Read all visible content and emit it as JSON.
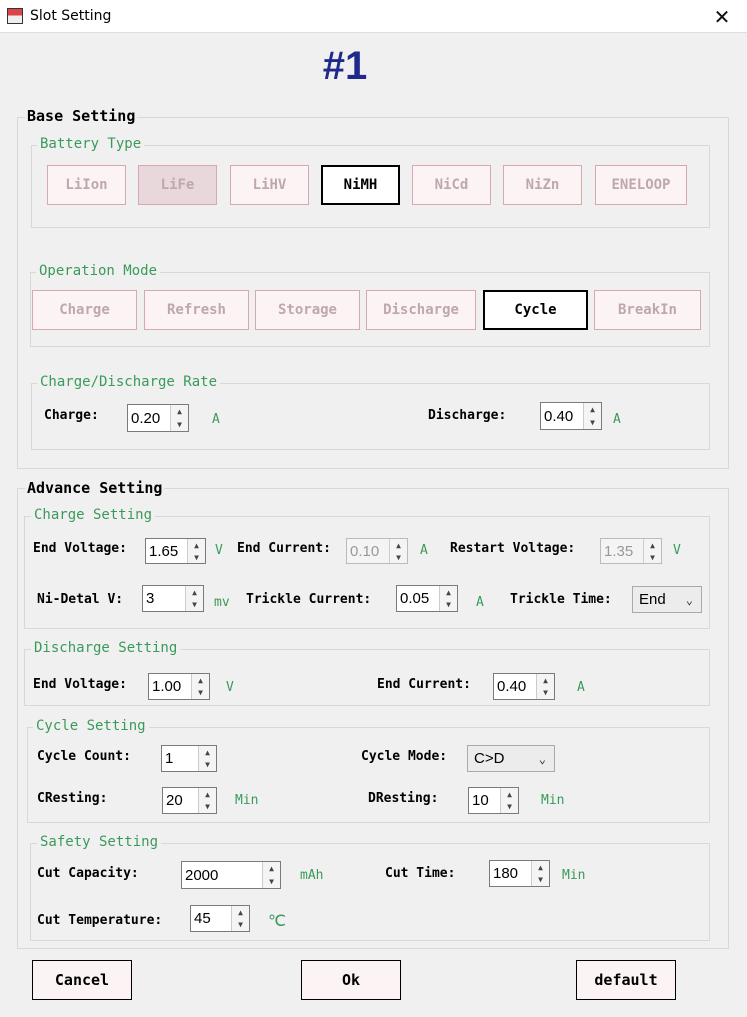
{
  "window": {
    "title": "Slot Setting",
    "close_glyph": "✕"
  },
  "slot_label": "#1",
  "base": {
    "title": "Base Setting",
    "battery_type": {
      "legend": "Battery Type",
      "options": [
        "LiIon",
        "LiFe",
        "LiHV",
        "NiMH",
        "NiCd",
        "NiZn",
        "ENELOOP"
      ],
      "selected": "NiMH"
    },
    "operation_mode": {
      "legend": "Operation Mode",
      "options": [
        "Charge",
        "Refresh",
        "Storage",
        "Discharge",
        "Cycle",
        "BreakIn"
      ],
      "selected": "Cycle"
    },
    "rate": {
      "legend": "Charge/Discharge Rate",
      "charge_label": "Charge:",
      "charge_value": "0.20",
      "charge_unit": "A",
      "discharge_label": "Discharge:",
      "discharge_value": "0.40",
      "discharge_unit": "A"
    }
  },
  "advance": {
    "title": "Advance Setting",
    "charge": {
      "legend": "Charge Setting",
      "end_voltage_label": "End Voltage:",
      "end_voltage_value": "1.65",
      "end_voltage_unit": "V",
      "end_current_label": "End Current:",
      "end_current_value": "0.10",
      "end_current_unit": "A",
      "restart_voltage_label": "Restart Voltage:",
      "restart_voltage_value": "1.35",
      "restart_voltage_unit": "V",
      "delta_label": "Ni-Detal V:",
      "delta_value": "3",
      "delta_unit": "mv",
      "trickle_current_label": "Trickle Current:",
      "trickle_current_value": "0.05",
      "trickle_current_unit": "A",
      "trickle_time_label": "Trickle Time:",
      "trickle_time_value": "End"
    },
    "discharge": {
      "legend": "Discharge Setting",
      "end_voltage_label": "End Voltage:",
      "end_voltage_value": "1.00",
      "end_voltage_unit": "V",
      "end_current_label": "End Current:",
      "end_current_value": "0.40",
      "end_current_unit": "A"
    },
    "cycle": {
      "legend": "Cycle Setting",
      "count_label": "Cycle Count:",
      "count_value": "1",
      "mode_label": "Cycle Mode:",
      "mode_value": "C>D",
      "cresting_label": "CResting:",
      "cresting_value": "20",
      "cresting_unit": "Min",
      "dresting_label": "DResting:",
      "dresting_value": "10",
      "dresting_unit": "Min"
    },
    "safety": {
      "legend": "Safety Setting",
      "capacity_label": "Cut Capacity:",
      "capacity_value": "2000",
      "capacity_unit": "mAh",
      "time_label": "Cut Time:",
      "time_value": "180",
      "time_unit": "Min",
      "temp_label": "Cut Temperature:",
      "temp_value": "45",
      "temp_unit": "℃"
    }
  },
  "footer": {
    "cancel": "Cancel",
    "ok": "Ok",
    "default": "default"
  }
}
